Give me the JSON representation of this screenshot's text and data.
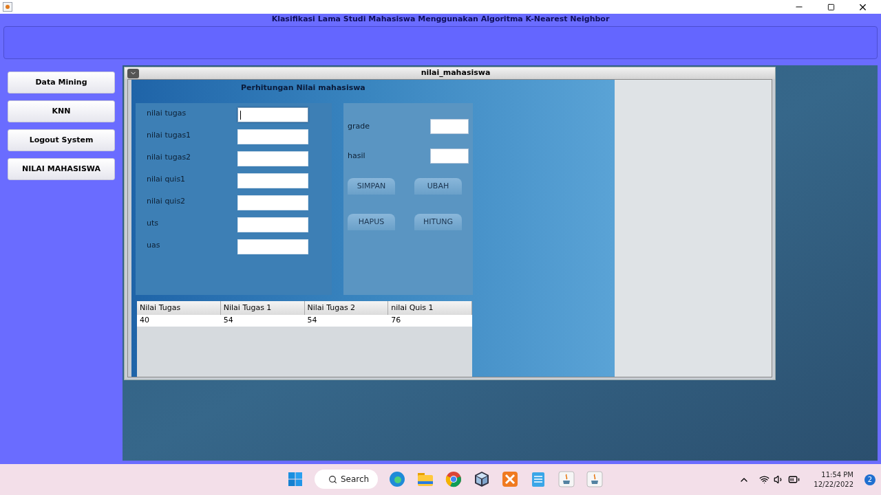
{
  "window": {
    "title": "Klasifikasi Lama Studi Mahasiswa Menggunakan Algoritma K-Nearest Neighbor"
  },
  "sidebar": {
    "items": [
      "Data Mining",
      "KNN",
      "Logout System",
      "NILAI MAHASISWA"
    ]
  },
  "internal_frame": {
    "title": "nilai_mahasiswa",
    "heading": "Perhitungan Nilai mahasiswa",
    "fields": [
      {
        "label": "nilai tugas",
        "focused": true
      },
      {
        "label": "nilai tugas1",
        "focused": false
      },
      {
        "label": "nilai tugas2",
        "focused": false
      },
      {
        "label": "nilai quis1",
        "focused": false
      },
      {
        "label": "nilai quis2",
        "focused": false
      },
      {
        "label": "uts",
        "focused": false
      },
      {
        "label": "uas",
        "focused": false
      }
    ],
    "result_fields": [
      "grade",
      "hasil"
    ],
    "buttons": [
      "SIMPAN",
      "UBAH",
      "HAPUS",
      "HITUNG"
    ],
    "table": {
      "columns": [
        "Nilai Tugas",
        "Nilai Tugas 1",
        "Nilai Tugas 2",
        "nilai Quis 1"
      ],
      "rows": [
        [
          "40",
          "54",
          "54",
          "76"
        ]
      ]
    }
  },
  "taskbar": {
    "search": "Search",
    "time": "11:54 PM",
    "date": "12/22/2022",
    "notifications": "2"
  }
}
